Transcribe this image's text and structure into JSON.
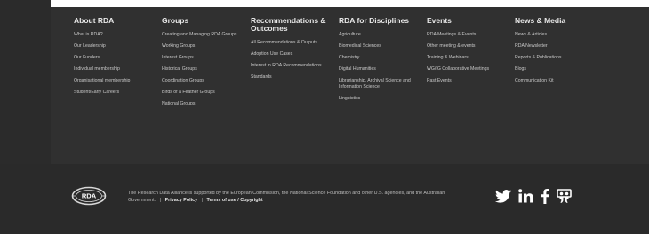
{
  "footer": {
    "columns": [
      {
        "heading": "About RDA",
        "links": [
          "What is RDA?",
          "Our Leadership",
          "Our Funders",
          "Individual membership",
          "Organisational membership",
          "Student/Early Careers"
        ]
      },
      {
        "heading": "Groups",
        "links": [
          "Creating and Managing RDA Groups",
          "Working Groups",
          "Interest Groups",
          "Historical Groups",
          "Coordination Groups",
          "Birds of a Feather Groups",
          "National Groups"
        ]
      },
      {
        "heading": "Recommendations & Outcomes",
        "links": [
          "All Recommendations & Outputs",
          "Adoption Use Cases",
          "Interest in RDA Recommendations",
          "Standards"
        ]
      },
      {
        "heading": "RDA for Disciplines",
        "links": [
          "Agriculture",
          "Biomedical Sciences",
          "Chemistry",
          "Digital Humanities",
          "Librarianship, Archival Science and Information Science",
          "Linguistics"
        ]
      },
      {
        "heading": "Events",
        "links": [
          "RDA Meetings & Events",
          "Other meeting & events",
          "Training & Webinars",
          "WG/IG Collaborative Meetings",
          "Past Events"
        ]
      },
      {
        "heading": "News & Media",
        "links": [
          "News & Articles",
          "RDA Newsletter",
          "Reports & Publications",
          "Blogs",
          "Communication Kit"
        ]
      }
    ],
    "logo_text": "RDA",
    "disclaimer": "The Research Data Alliance is supported by the European Commission, the National Science Foundation and other U.S. agencies, and the Australian Government.",
    "separator": "|",
    "privacy_label": "Privacy Policy",
    "terms_label": "Terms of use / Copyright",
    "social_icons": [
      "twitter-icon",
      "linkedin-icon",
      "facebook-icon",
      "slideshare-icon"
    ]
  },
  "colors": {
    "background": "#2f2f2f",
    "bottom_band": "#2a2a2a",
    "heading": "#e8e8e8",
    "link": "#c9c9c9"
  }
}
